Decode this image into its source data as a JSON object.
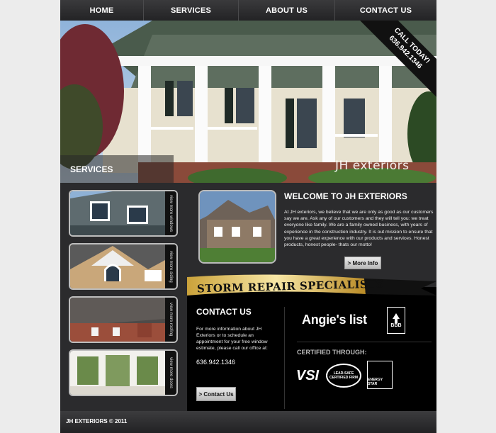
{
  "nav": {
    "items": [
      {
        "label": "HOME",
        "width": 118
      },
      {
        "label": "SERVICES",
        "width": 134
      },
      {
        "label": "ABOUT US",
        "width": 136
      },
      {
        "label": "CONTACT US",
        "width": 143
      }
    ]
  },
  "hero": {
    "services_label": "SERVICES",
    "logo_text": "JH exteriors",
    "call_line1": "CALL TODAY!",
    "call_line2": "636.942.1346"
  },
  "thumbs": [
    {
      "label": "view more windows"
    },
    {
      "label": "view more siding"
    },
    {
      "label": "view more roofing"
    },
    {
      "label": "view more doors"
    }
  ],
  "welcome": {
    "title": "WELCOME TO JH EXTERIORS",
    "text": "At JH exteriors, we believe that we are only as good as our customers say we are. Ask any of our customers and they will tell you: we treat everyone like family. We are a family owned business, with years of experience in the construction industry. It is out mission to ensure that you have a great experience with our products and services. Honest products, honest people- thats our motto!",
    "more_info_label": "> More Info"
  },
  "storm": {
    "label": "STORM REPAIR SPECIALISTS"
  },
  "contact": {
    "title": "CONTACT US",
    "text": "For more information about JH Exteriors or to schedule an appointment for your free window estimate, please call our office at:",
    "phone": "636.942.1346",
    "button_label": "> Contact Us"
  },
  "certs": {
    "angies": "Angie's list",
    "bbb": "BBB",
    "title": "CERTIFIED THROUGH:",
    "vsi": "VSI",
    "epa": "LEAD-SAFE CERTIFIED FIRM",
    "energy": "ENERGY STAR"
  },
  "footer": {
    "text": "JH EXTERIORS © 2011"
  }
}
